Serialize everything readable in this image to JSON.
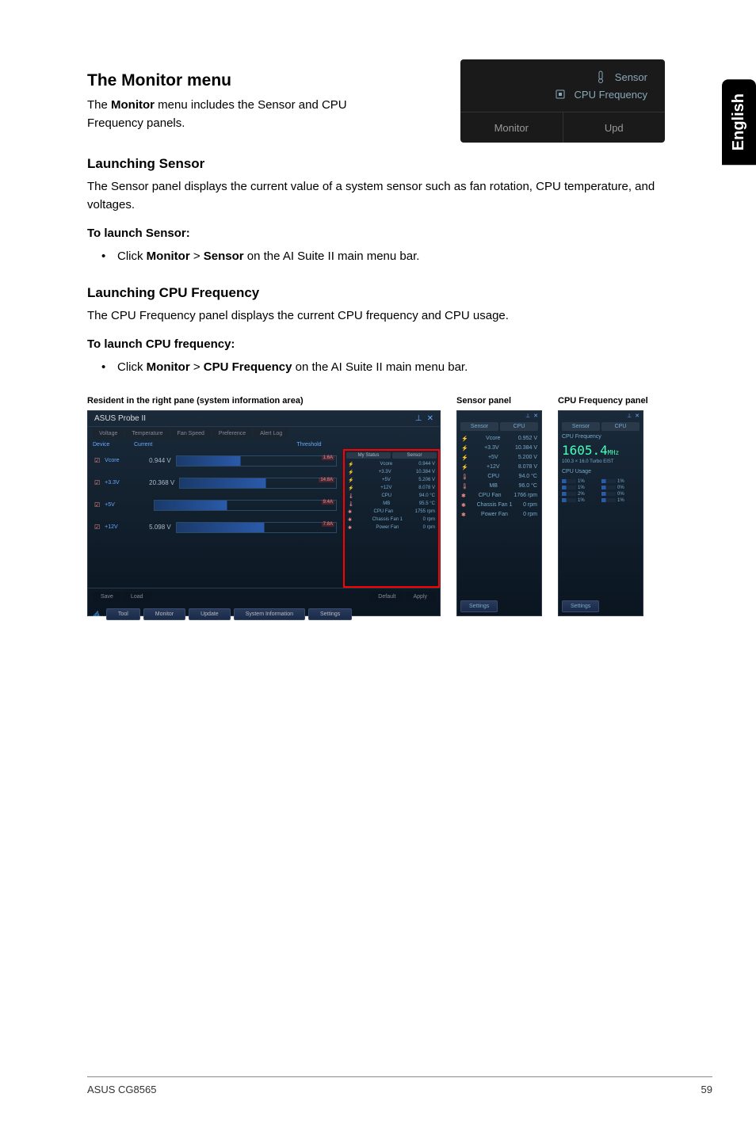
{
  "sideTab": "English",
  "title": "The Monitor menu",
  "intro_prefix": "The ",
  "intro_bold": "Monitor",
  "intro_suffix": " menu includes the Sensor and CPU Frequency panels.",
  "monitorMenu": {
    "sensor": "Sensor",
    "cpuFreq": "CPU Frequency",
    "monitorBtn": "Monitor",
    "updateBtn": "Upd"
  },
  "section1": {
    "heading": "Launching Sensor",
    "para": "The Sensor panel displays the current value of a system sensor such as fan rotation, CPU temperature, and voltages.",
    "subheading": "To launch Sensor:",
    "bullet_p1": "Click ",
    "bullet_b1": "Monitor",
    "bullet_mid": " > ",
    "bullet_b2": "Sensor",
    "bullet_p2": " on the AI Suite II main menu bar."
  },
  "section2": {
    "heading": "Launching CPU Frequency",
    "para": "The CPU Frequency panel displays the current CPU frequency and CPU usage.",
    "subheading": "To launch CPU frequency:",
    "bullet_p1": "Click ",
    "bullet_b1": "Monitor",
    "bullet_mid": " > ",
    "bullet_b2": "CPU Frequency",
    "bullet_p2": " on the AI Suite II main menu bar."
  },
  "captions": {
    "resident": "Resident in the right pane (system information area)",
    "sensor": "Sensor panel",
    "cpu": "CPU Frequency panel"
  },
  "probe": {
    "title": "ASUS  Probe II",
    "tabs": [
      "Voltage",
      "Temperature",
      "Fan Speed",
      "Preference",
      "Alert Log"
    ],
    "headers": [
      "Device",
      "Current",
      "Threshold"
    ],
    "rows": [
      {
        "label": "Vcore",
        "val": "0.944 V",
        "tag": "1.6A"
      },
      {
        "label": "+3.3V",
        "val": "20.368 V",
        "tag": "14.8A"
      },
      {
        "label": "+5V",
        "val": "",
        "tag": "9.4A"
      },
      {
        "label": "+12V",
        "val": "5.098 V",
        "tag": "7.8A"
      }
    ],
    "sideTabs": [
      "My Status",
      "Sensor"
    ],
    "sideRows": [
      {
        "name": "Vcore",
        "val": "0.944 V"
      },
      {
        "name": "+3.3V",
        "val": "10.384 V"
      },
      {
        "name": "+5V",
        "val": "5.206 V"
      },
      {
        "name": "+12V",
        "val": "8.078 V"
      },
      {
        "name": "CPU",
        "val": "94.0 °C"
      },
      {
        "name": "MB",
        "val": "95.5 °C"
      },
      {
        "name": "CPU Fan",
        "val": "1755 rpm"
      },
      {
        "name": "Chassis Fan 1",
        "val": "0 rpm"
      },
      {
        "name": "Power Fan",
        "val": "0 rpm"
      }
    ],
    "bottomBtns": [
      "Save",
      "Load",
      "Default",
      "Apply"
    ],
    "footerBtns": [
      "Tool",
      "Monitor",
      "Update",
      "System Information",
      "Settings"
    ]
  },
  "sensorPanel": {
    "tabs": [
      "Sensor",
      "CPU"
    ],
    "rows": [
      {
        "name": "Vcore",
        "val": "0.952 V"
      },
      {
        "name": "+3.3V",
        "val": "10.384 V"
      },
      {
        "name": "+5V",
        "val": "5.200 V"
      },
      {
        "name": "+12V",
        "val": "8.078 V"
      },
      {
        "name": "CPU",
        "val": "94.0 °C"
      },
      {
        "name": "MB",
        "val": "96.0 °C"
      },
      {
        "name": "CPU Fan",
        "val": "1766 rpm"
      },
      {
        "name": "Chassis Fan 1",
        "val": "0 rpm"
      },
      {
        "name": "Power Fan",
        "val": "0 rpm"
      }
    ],
    "footer": "Settings"
  },
  "cpuPanel": {
    "tabs": [
      "Sensor",
      "CPU"
    ],
    "freqLabel": "CPU Frequency",
    "freqValue": "1605.4",
    "freqUnit": "MHz",
    "sub": "100.3 × 16.0 Turbo EIST",
    "usageLabel": "CPU Usage",
    "cores": [
      {
        "name": "1%"
      },
      {
        "name": "1%"
      },
      {
        "name": "1%"
      },
      {
        "name": "0%"
      },
      {
        "name": "2%"
      },
      {
        "name": "0%"
      },
      {
        "name": "1%"
      },
      {
        "name": "1%"
      }
    ],
    "footer": "Settings"
  },
  "footer": {
    "left": "ASUS CG8565",
    "right": "59"
  }
}
